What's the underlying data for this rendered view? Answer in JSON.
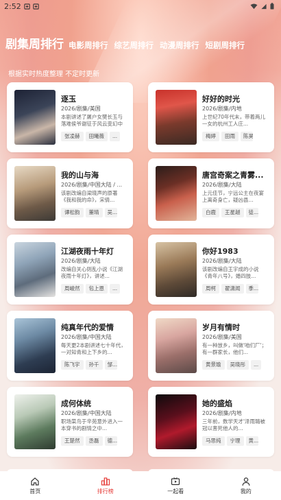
{
  "status": {
    "time": "2:52",
    "left_icons": [
      "notification-icon",
      "notification-icon"
    ],
    "right_icons": [
      "wifi-icon",
      "signal-icon",
      "battery-icon"
    ]
  },
  "tabs": [
    {
      "label": "剧集周排行",
      "active": true
    },
    {
      "label": "电影周排行",
      "active": false
    },
    {
      "label": "综艺周排行",
      "active": false
    },
    {
      "label": "动漫周排行",
      "active": false
    },
    {
      "label": "短剧周排行",
      "active": false
    }
  ],
  "subtitle": "根据实时热度整理 不定时更新",
  "items": [
    {
      "title": "逐玉",
      "meta": "2026/剧集/美国",
      "desc": "本剧讲述了屠户女樊长玉与落难侯爷谢征于风云变幻中",
      "tags": [
        "张凌赫",
        "田曦薇",
        "..."
      ]
    },
    {
      "title": "好好的时光",
      "meta": "2026/剧集/内地",
      "desc": "上世纪70年代末，带着两儿一女的杭州工人庄...",
      "tags": [
        "梅婷",
        "田雨",
        "陈昊..."
      ]
    },
    {
      "title": "我的山与海",
      "meta": "2026/剧集/中国大陆 / ...",
      "desc": "该剧改编自梁晓声的原著《我和我的命》，宋倩...",
      "tags": [
        "谭松韵",
        "董晴",
        "吴..."
      ]
    },
    {
      "title": "唐宫奇案之青雾...",
      "meta": "2026/剧集/大陆",
      "desc": "上元佳节，宁远公主在夜宴上离奇身亡，疑凶县...",
      "tags": [
        "白鹿",
        "王星越",
        "徒..."
      ]
    },
    {
      "title": "江湖夜雨十年灯",
      "meta": "2026/剧集/大陆",
      "desc": "改编自关心则乱小说《江湖夜雨十年灯》，讲述...",
      "tags": [
        "周峻然",
        "包上恩",
        "..."
      ]
    },
    {
      "title": "你好1983",
      "meta": "2026/剧集/大陆",
      "desc": "该剧改编自王宇成的小说《青年八号》，婚四肢...",
      "tags": [
        "周柯",
        "翟潇闻",
        "季..."
      ]
    },
    {
      "title": "纯真年代的爱情",
      "meta": "2026/剧集/中国大陆",
      "desc": "每天更2本剧讲述七十年代，一对知青和上下乡的...",
      "tags": [
        "陈飞宇",
        "孙千",
        "邹..."
      ]
    },
    {
      "title": "岁月有情时",
      "meta": "2026/剧集/美国",
      "desc": "有一种放乡，叫做'咱们厂'；有一群家长，他们...",
      "tags": [
        "黄景瑜",
        "吴晓彤",
        "..."
      ]
    },
    {
      "title": "成何体统",
      "meta": "2026/剧集/中国大陆",
      "desc": "职场菜鸟于辛苑意外进入一本穿书的剧情之中...",
      "tags": [
        "王楚然",
        "丞磊",
        "德..."
      ]
    },
    {
      "title": "她的盛焰",
      "meta": "2026/剧集/内地",
      "desc": "三年前，数学天才'泽雨璐被冠以害死他人的...",
      "tags": [
        "马思纯",
        "宁理",
        "黄..."
      ]
    }
  ],
  "nav": [
    {
      "label": "首页",
      "icon": "home-icon",
      "active": false
    },
    {
      "label": "排行榜",
      "icon": "ranking-icon",
      "active": true
    },
    {
      "label": "一起看",
      "icon": "watch-together-icon",
      "active": false
    },
    {
      "label": "我的",
      "icon": "profile-icon",
      "active": false
    }
  ],
  "colors": {
    "accent": "#e53935",
    "header_bg": "#f3a998",
    "page_bg": "#f7ece8"
  }
}
